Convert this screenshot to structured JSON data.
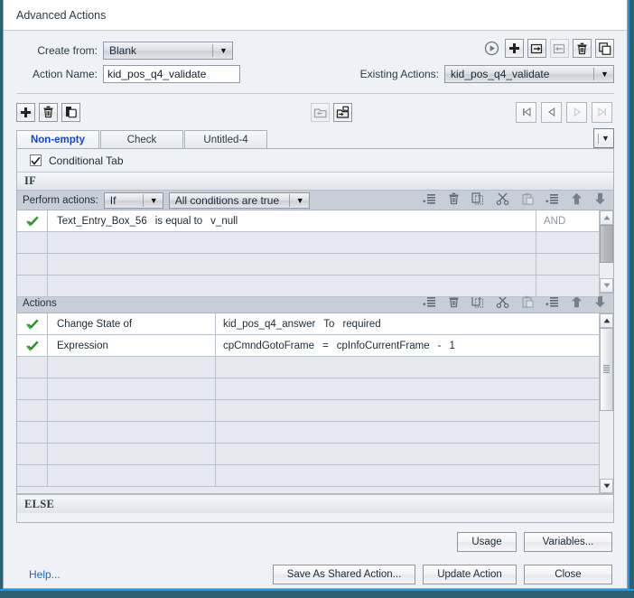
{
  "window": {
    "title": "Advanced Actions"
  },
  "form": {
    "create_from_label": "Create from:",
    "create_from_value": "Blank",
    "action_name_label": "Action Name:",
    "action_name_value": "kid_pos_q4_validate",
    "existing_actions_label": "Existing Actions:",
    "existing_actions_value": "kid_pos_q4_validate"
  },
  "top_icons": [
    {
      "name": "preview-action-button",
      "icon": "play-circle-icon",
      "disabled": false
    },
    {
      "name": "add-action-button",
      "icon": "plus-icon",
      "disabled": false
    },
    {
      "name": "export-action-button",
      "icon": "export-folder-icon",
      "disabled": false
    },
    {
      "name": "import-action-button",
      "icon": "import-folder-icon",
      "disabled": true
    },
    {
      "name": "delete-action-button",
      "icon": "trash-icon",
      "disabled": false
    },
    {
      "name": "duplicate-action-button",
      "icon": "duplicate-icon",
      "disabled": false
    }
  ],
  "tab_toolbar": {
    "left": [
      {
        "name": "add-tab-button",
        "icon": "plus-icon"
      },
      {
        "name": "delete-tab-button",
        "icon": "trash-icon"
      },
      {
        "name": "duplicate-tab-button",
        "icon": "copy-icon"
      }
    ],
    "middle": [
      {
        "name": "import-decision-button",
        "icon": "folder-in-icon"
      },
      {
        "name": "export-decision-button",
        "icon": "folder-out-icon"
      }
    ],
    "nav": [
      {
        "name": "first-tab-button",
        "icon": "first-icon",
        "disabled": false
      },
      {
        "name": "previous-tab-button",
        "icon": "prev-icon",
        "disabled": false
      },
      {
        "name": "next-tab-button",
        "icon": "next-icon",
        "disabled": true
      },
      {
        "name": "last-tab-button",
        "icon": "last-icon",
        "disabled": true
      }
    ]
  },
  "tabs": [
    {
      "label": "Non-empty",
      "active": true
    },
    {
      "label": "Check",
      "active": false
    },
    {
      "label": "Untitled-4",
      "active": false
    }
  ],
  "conditional_tab": {
    "label": "Conditional Tab",
    "checked": true
  },
  "if_section": {
    "header": "IF",
    "perform_label": "Perform actions:",
    "perform_mode": "If",
    "condition_mode": "All conditions are true",
    "toolbar": [
      {
        "name": "add-condition-button",
        "icon": "add-row-icon",
        "disabled": false
      },
      {
        "name": "delete-condition-button",
        "icon": "trash-icon",
        "disabled": false
      },
      {
        "name": "copy-condition-button",
        "icon": "copy-icon",
        "disabled": false
      },
      {
        "name": "cut-condition-button",
        "icon": "scissors-icon",
        "disabled": false
      },
      {
        "name": "paste-condition-button",
        "icon": "paste-icon",
        "disabled": true
      },
      {
        "name": "insert-condition-button",
        "icon": "insert-row-icon",
        "disabled": false
      },
      {
        "name": "move-condition-up-button",
        "icon": "arrow-up-icon",
        "disabled": false
      },
      {
        "name": "move-condition-down-button",
        "icon": "arrow-down-icon",
        "disabled": false
      }
    ],
    "rows": [
      {
        "enabled": true,
        "left": "Text_Entry_Box_56",
        "operator": "is equal to",
        "right": "v_null",
        "conjunction": "AND"
      }
    ],
    "empty_rows": 3
  },
  "actions_section": {
    "header": "Actions",
    "toolbar": [
      {
        "name": "add-action-row-button",
        "icon": "add-row-icon",
        "disabled": false
      },
      {
        "name": "delete-action-row-button",
        "icon": "trash-icon",
        "disabled": false
      },
      {
        "name": "copy-action-row-button",
        "icon": "copy-icon",
        "disabled": false
      },
      {
        "name": "cut-action-row-button",
        "icon": "scissors-icon",
        "disabled": false
      },
      {
        "name": "paste-action-row-button",
        "icon": "paste-icon",
        "disabled": true
      },
      {
        "name": "insert-action-row-button",
        "icon": "insert-row-icon",
        "disabled": false
      },
      {
        "name": "move-action-up-button",
        "icon": "arrow-up-icon",
        "disabled": false
      },
      {
        "name": "move-action-down-button",
        "icon": "arrow-down-icon",
        "disabled": false
      }
    ],
    "rows": [
      {
        "enabled": true,
        "action": "Change State of",
        "p1": "kid_pos_q4_answer",
        "p2": "To",
        "p3": "required",
        "p4": "",
        "p5": ""
      },
      {
        "enabled": true,
        "action": "Expression",
        "p1": "cpCmndGotoFrame",
        "p2": "=",
        "p3": "cpInfoCurrentFrame",
        "p4": "-",
        "p5": "1"
      }
    ],
    "empty_rows": 6
  },
  "else_section": {
    "header": "ELSE"
  },
  "footer": {
    "usage_label": "Usage",
    "variables_label": "Variables...",
    "help_label": "Help...",
    "save_shared_label": "Save As Shared Action...",
    "update_label": "Update Action",
    "close_label": "Close"
  },
  "colors": {
    "accent_link": "#1469d0",
    "active_tab_text": "#1346d8",
    "check_green": "#36a832",
    "chrome_teal": "#2d6073",
    "chrome_blue": "#2196e3",
    "panel_bg": "#eef1f5",
    "grid_empty": "#e6e9f0"
  }
}
